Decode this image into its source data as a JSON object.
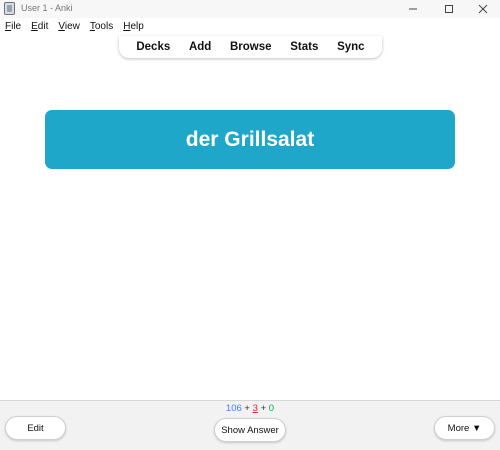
{
  "window": {
    "title": "User 1 - Anki",
    "icons": {
      "app": "anki-app-icon",
      "minimize": "minimize-icon",
      "maximize": "maximize-icon",
      "close": "close-icon"
    }
  },
  "menubar": {
    "items": [
      {
        "accel": "F",
        "rest": "ile"
      },
      {
        "accel": "E",
        "rest": "dit"
      },
      {
        "accel": "V",
        "rest": "iew"
      },
      {
        "accel": "T",
        "rest": "ools"
      },
      {
        "accel": "H",
        "rest": "elp"
      }
    ]
  },
  "toolbar": {
    "links": [
      "Decks",
      "Add",
      "Browse",
      "Stats",
      "Sync"
    ]
  },
  "card": {
    "front": "der Grillsalat",
    "color": "#1ea7c9"
  },
  "counts": {
    "new": "106",
    "learn": "3",
    "review": "0",
    "separator": "+",
    "colors": {
      "new": "#3b82f6",
      "learn": "#dc2626",
      "review": "#16a34a"
    }
  },
  "buttons": {
    "edit": "Edit",
    "show_answer": "Show Answer",
    "more": "More ▼"
  }
}
